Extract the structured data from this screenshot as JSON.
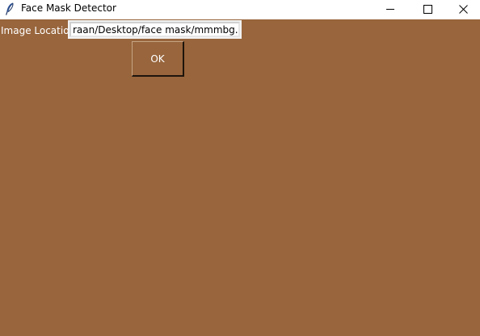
{
  "window": {
    "title": "Face Mask Detector",
    "icon": "feather-icon"
  },
  "controls": {
    "minimize_icon": "minimize-icon",
    "maximize_icon": "maximize-icon",
    "close_icon": "close-icon"
  },
  "form": {
    "location_label": "Image Location",
    "location_value": "raan/Desktop/face mask/mmmbg.png",
    "ok_label": "OK"
  },
  "colors": {
    "background": "#98653c",
    "text": "#ffffff"
  }
}
